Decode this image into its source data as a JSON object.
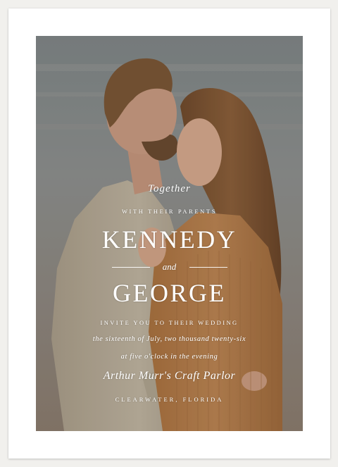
{
  "invitation": {
    "together": "Together",
    "with_parents": "WITH THEIR PARENTS",
    "name_one": "KENNEDY",
    "and": "and",
    "name_two": "GEORGE",
    "invite_line": "INVITE YOU TO THEIR WEDDING",
    "date_line": "the sixteenth of July, two thousand twenty-six",
    "time_line": "at five o'clock in the evening",
    "venue": "Arthur Murr's Craft Parlor",
    "location": "CLEARWATER, FLORIDA"
  },
  "colors": {
    "page_background": "#f1f0ed",
    "card": "#ffffff",
    "text": "#ffffff",
    "sweater": "#b07a48",
    "jacket": "#b6ab98"
  }
}
